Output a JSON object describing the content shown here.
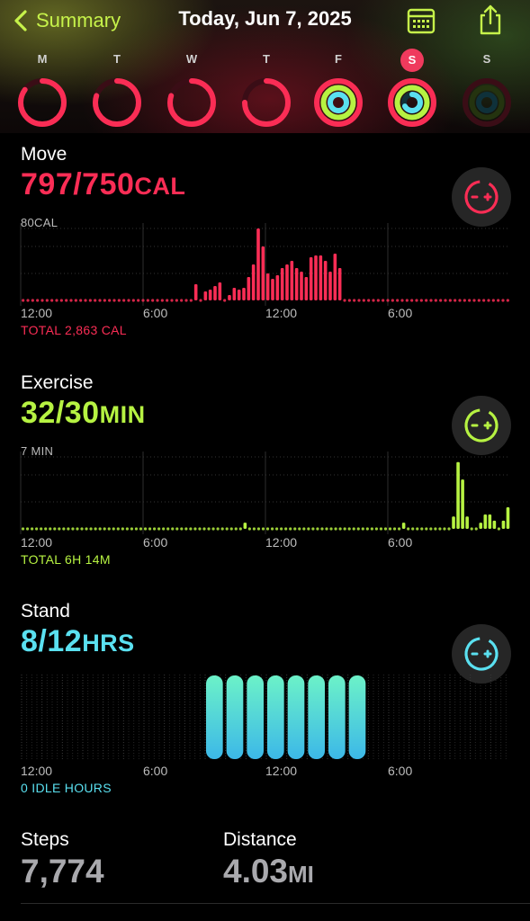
{
  "nav": {
    "back_label": "Summary",
    "title": "Today, Jun 7, 2025"
  },
  "week": [
    {
      "label": "M",
      "move": 0.85,
      "exercise": 0,
      "stand": 0
    },
    {
      "label": "T",
      "move": 0.8,
      "exercise": 0,
      "stand": 0
    },
    {
      "label": "W",
      "move": 0.8,
      "exercise": 0,
      "stand": 0
    },
    {
      "label": "T",
      "move": 0.75,
      "exercise": 0,
      "stand": 0
    },
    {
      "label": "F",
      "move": 1.0,
      "exercise": 1.0,
      "stand": 1.0
    },
    {
      "label": "S",
      "move": 1.0,
      "exercise": 1.0,
      "stand": 0.67,
      "selected": true
    },
    {
      "label": "S",
      "move": 0,
      "exercise": 0,
      "stand": 0
    }
  ],
  "colors": {
    "move": "#fa2d55",
    "exercise": "#b6f242",
    "stand": "#5ae0f0",
    "back": "#c6f24a"
  },
  "move": {
    "title": "Move",
    "value": "797/750",
    "unit": "CAL",
    "max_label": "80CAL",
    "ticks": [
      "12:00",
      "6:00",
      "12:00",
      "6:00"
    ],
    "total": "TOTAL 2,863 CAL",
    "edit_icon": "ring-edit-icon"
  },
  "exercise": {
    "title": "Exercise",
    "value": "32/30",
    "unit": "MIN",
    "max_label": "7 MIN",
    "ticks": [
      "12:00",
      "6:00",
      "12:00",
      "6:00"
    ],
    "total": "TOTAL 6H 14M",
    "edit_icon": "ring-edit-icon"
  },
  "stand": {
    "title": "Stand",
    "value": "8/12",
    "unit": "HRS",
    "ticks": [
      "12:00",
      "6:00",
      "12:00",
      "6:00"
    ],
    "total": "0 IDLE HOURS",
    "edit_icon": "ring-edit-icon"
  },
  "steps": {
    "label": "Steps",
    "value": "7,774"
  },
  "distance": {
    "label": "Distance",
    "value": "4.03",
    "unit": "MI"
  },
  "chart_data": [
    {
      "type": "bar",
      "name": "Move",
      "x_unit": "15-minute intervals from 12:00 AM",
      "ylim": [
        0,
        80
      ],
      "values": [
        0,
        0,
        0,
        0,
        0,
        0,
        0,
        0,
        0,
        0,
        0,
        0,
        0,
        0,
        0,
        0,
        0,
        0,
        0,
        0,
        0,
        0,
        0,
        0,
        0,
        0,
        0,
        0,
        0,
        0,
        0,
        0,
        0,
        0,
        0,
        0,
        18,
        0,
        10,
        12,
        16,
        20,
        0,
        6,
        14,
        12,
        14,
        26,
        40,
        80,
        60,
        30,
        24,
        28,
        36,
        40,
        44,
        36,
        32,
        26,
        48,
        50,
        50,
        44,
        32,
        52,
        36,
        0,
        0,
        0,
        0,
        0,
        0,
        0,
        0,
        0,
        0,
        0,
        0,
        0,
        0,
        0,
        0,
        0,
        0,
        0,
        0,
        0,
        0,
        0,
        0,
        0,
        0,
        0,
        0,
        0,
        0,
        0,
        0,
        0,
        0,
        0
      ]
    },
    {
      "type": "bar",
      "name": "Exercise",
      "x_unit": "15-minute intervals from 12:00 AM",
      "ylim": [
        0,
        7
      ],
      "values": [
        0,
        0,
        0,
        0,
        0,
        0,
        0,
        0,
        0,
        0,
        0,
        0,
        0,
        0,
        0,
        0,
        0,
        0,
        0,
        0,
        0,
        0,
        0,
        0,
        0,
        0,
        0,
        0,
        0,
        0,
        0,
        0,
        0,
        0,
        0,
        0,
        0,
        0,
        0,
        0,
        0,
        0,
        0,
        0,
        0,
        0,
        0,
        0,
        0,
        0,
        0,
        0,
        0,
        0,
        0,
        0,
        0,
        0,
        0,
        0,
        0,
        0,
        0,
        0,
        0,
        0,
        0,
        0,
        0,
        0,
        0,
        0,
        0,
        0,
        0,
        0,
        0,
        0,
        0,
        0,
        0,
        0,
        0,
        0,
        0,
        0,
        0,
        0,
        0,
        0,
        0,
        0,
        0,
        0,
        0,
        0,
        0,
        0,
        0,
        0,
        0,
        0,
        0,
        0,
        0,
        0,
        0,
        0
      ],
      "points": [
        [
          12.25,
          0.6
        ],
        [
          21.0,
          0.6
        ],
        [
          23.75,
          1.2
        ],
        [
          24.0,
          6.5
        ],
        [
          24.25,
          4.8
        ],
        [
          24.5,
          1.2
        ],
        [
          25.25,
          0.6
        ],
        [
          25.5,
          1.4
        ],
        [
          25.75,
          1.4
        ],
        [
          26.0,
          0.8
        ],
        [
          26.5,
          0.8
        ],
        [
          26.75,
          2.1
        ],
        [
          27.0,
          1.4
        ],
        [
          27.25,
          0.6
        ],
        [
          27.5,
          1.4
        ],
        [
          27.75,
          1.4
        ]
      ]
    },
    {
      "type": "bar",
      "name": "Stand",
      "x_unit": "hour of day",
      "ylim": [
        0,
        1
      ],
      "values": [
        0,
        0,
        0,
        0,
        0,
        0,
        0,
        0,
        0,
        1,
        1,
        1,
        1,
        1,
        1,
        1,
        1,
        0,
        0,
        0,
        0,
        0,
        0,
        0
      ]
    }
  ]
}
